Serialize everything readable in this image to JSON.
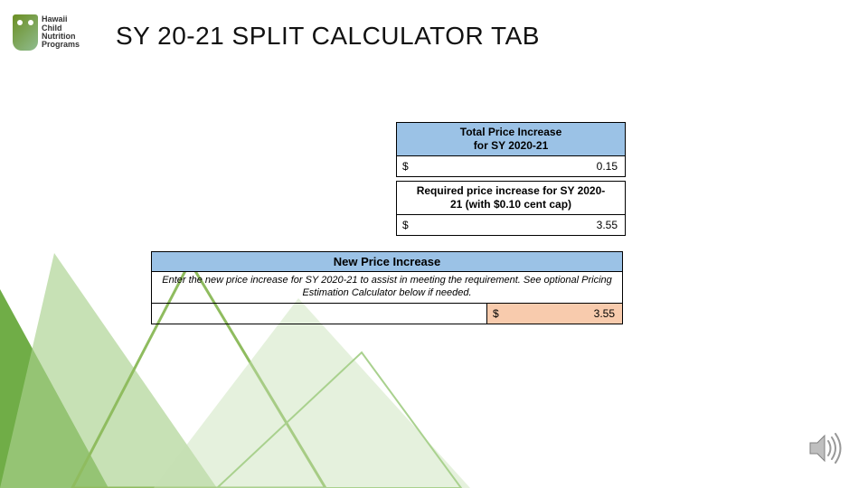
{
  "logo": {
    "line1": "Hawaii",
    "line2": "Child",
    "line3": "Nutrition",
    "line4": "Programs"
  },
  "title": "SY 20-21 SPLIT CALCULATOR TAB",
  "box1": {
    "header_line1": "Total Price Increase",
    "header_line2": "for SY 2020-21",
    "currency": "$",
    "value": "0.15"
  },
  "box2": {
    "header_line1": "Required price increase for SY 2020-",
    "header_line2": "21 (with $0.10 cent cap)",
    "currency": "$",
    "value": "3.55"
  },
  "box3": {
    "header": "New Price Increase",
    "instructions": "Enter the new price increase for SY 2020-21 to assist in meeting the requirement. See optional Pricing Estimation Calculator below if needed.",
    "currency": "$",
    "value": "3.55"
  },
  "icons": {
    "sound": "sound-icon"
  }
}
